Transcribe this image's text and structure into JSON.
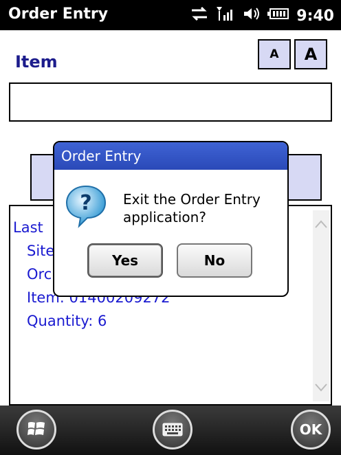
{
  "statusbar": {
    "title": "Order Entry",
    "time": "9:40",
    "icons": [
      "sync-icon",
      "signal-icon",
      "volume-icon",
      "battery-icon"
    ]
  },
  "header": {
    "item_label": "Item",
    "font_small_label": "A",
    "font_large_label": "A"
  },
  "item_input": {
    "value": ""
  },
  "list": {
    "lines": [
      "Last",
      "Site",
      "Orc",
      "Item: 01400209272",
      "Quantity: 6"
    ]
  },
  "dialog": {
    "title": "Order Entry",
    "message_line1": "Exit the Order Entry",
    "message_line2": "application?",
    "yes_label": "Yes",
    "no_label": "No"
  },
  "bottombar": {
    "ok_label": "OK"
  },
  "colors": {
    "accent_blue": "#2a49b8",
    "text_blue": "#1a1ad0",
    "button_fill": "#d7d9f4"
  }
}
